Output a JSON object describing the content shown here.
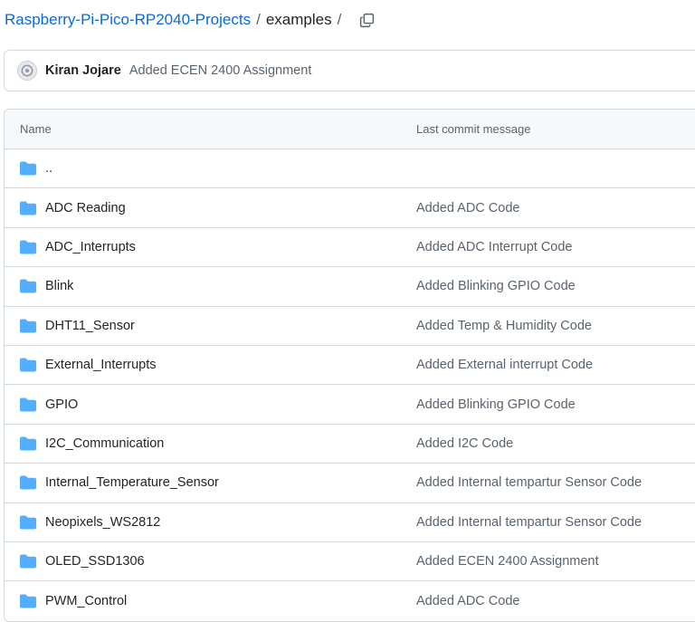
{
  "breadcrumb": {
    "repo": "Raspberry-Pi-Pico-RP2040-Projects",
    "separator": "/",
    "current": "examples",
    "trailing_separator": "/",
    "copy_icon": "copy-icon"
  },
  "latest_commit": {
    "author": "Kiran Jojare",
    "message": "Added ECEN 2400 Assignment"
  },
  "table": {
    "headers": {
      "name": "Name",
      "message": "Last commit message"
    },
    "parent": {
      "name": ".."
    },
    "rows": [
      {
        "name": "ADC Reading",
        "message": "Added ADC Code"
      },
      {
        "name": "ADC_Interrupts",
        "message": "Added ADC Interrupt Code"
      },
      {
        "name": "Blink",
        "message": "Added Blinking GPIO Code"
      },
      {
        "name": "DHT11_Sensor",
        "message": "Added Temp & Humidity Code"
      },
      {
        "name": "External_Interrupts",
        "message": "Added External interrupt Code"
      },
      {
        "name": "GPIO",
        "message": "Added Blinking GPIO Code"
      },
      {
        "name": "I2C_Communication",
        "message": "Added I2C Code"
      },
      {
        "name": "Internal_Temperature_Sensor",
        "message": "Added Internal tempartur Sensor Code"
      },
      {
        "name": "Neopixels_WS2812",
        "message": "Added Internal tempartur Sensor Code"
      },
      {
        "name": "OLED_SSD1306",
        "message": "Added ECEN 2400 Assignment"
      },
      {
        "name": "PWM_Control",
        "message": "Added ADC Code"
      }
    ]
  },
  "colors": {
    "link": "#0969da",
    "folder": "#54aeff",
    "border": "#d1d9e0",
    "muted_text": "#59636e"
  }
}
